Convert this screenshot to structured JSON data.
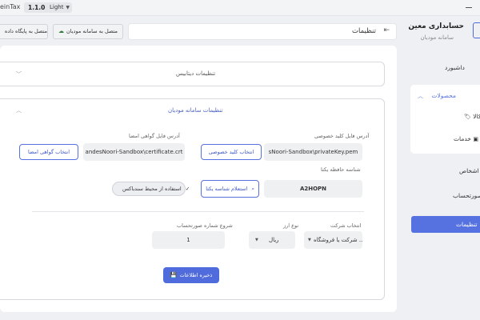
{
  "topbar": {
    "app_name": "einTax",
    "version": "1.1.0",
    "theme": "Light"
  },
  "sidebar": {
    "brand_title": "حسابداری معین",
    "brand_subtitle": "سامانه مودیان",
    "items": [
      {
        "label": "داشبورد"
      },
      {
        "label": "محصولات"
      },
      {
        "label": "کالا"
      },
      {
        "label": "خدمات"
      },
      {
        "label": "اشخاص"
      },
      {
        "label": "صورتحساب"
      },
      {
        "label": "تنظیمات"
      }
    ]
  },
  "header": {
    "title": "تنظیمات",
    "connect_tax_label": "متصل به سامانه مودیان",
    "connect_db_label": "متصل به پایگاه داده"
  },
  "database_card": {
    "title": "تنظیمات دیتابیس"
  },
  "tax_card": {
    "title": "تنظیمات سامانه مودیان",
    "private_key_label": "آدرس فایل کلید خصوصی",
    "private_key_value": "sNoori-Sandbox\\privateKey.pem",
    "private_key_button": "انتخاب کلید خصوصی",
    "certificate_label": "آدرس فایل گواهی امضا",
    "certificate_value": "andesNoori-Sandbox\\certificate.crt",
    "certificate_button": "انتخاب گواهی امضا",
    "memory_id_label": "شناسه حافظه یکتا",
    "memory_id_value": "A2HOPN",
    "memory_id_button": "استعلام شناسه یکتا",
    "sandbox_toggle": "استفاده از محیط سندباکس",
    "company_label": "انتخاب شرکت",
    "company_value": "شرکت یا فروشگاه ...",
    "currency_label": "نوع ارز",
    "currency_value": "ریال",
    "invoice_start_label": "شروع شماره صورتحساب",
    "invoice_start_value": "1",
    "save_button": "ذخیره اطلاعات"
  }
}
